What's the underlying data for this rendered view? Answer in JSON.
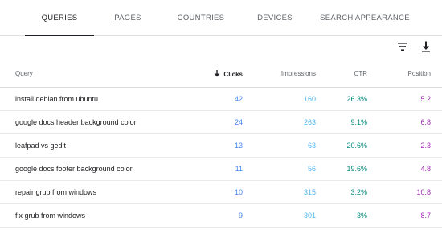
{
  "tabs": [
    {
      "label": "QUERIES",
      "active": true
    },
    {
      "label": "PAGES",
      "active": false
    },
    {
      "label": "COUNTRIES",
      "active": false
    },
    {
      "label": "DEVICES",
      "active": false
    },
    {
      "label": "SEARCH APPEARANCE",
      "active": false
    }
  ],
  "toolbar": {
    "filter_icon": "filter-icon",
    "download_icon": "download-icon"
  },
  "table": {
    "headers": {
      "query": "Query",
      "clicks": "Clicks",
      "impressions": "Impressions",
      "ctr": "CTR",
      "position": "Position"
    },
    "sort_icon": "arrow-down-icon",
    "rows": [
      {
        "query": "install debian from ubuntu",
        "clicks": "42",
        "impressions": "160",
        "ctr": "26.3%",
        "position": "5.2"
      },
      {
        "query": "google docs header background color",
        "clicks": "24",
        "impressions": "263",
        "ctr": "9.1%",
        "position": "6.8"
      },
      {
        "query": "leafpad vs gedit",
        "clicks": "13",
        "impressions": "63",
        "ctr": "20.6%",
        "position": "2.3"
      },
      {
        "query": "google docs footer background color",
        "clicks": "11",
        "impressions": "56",
        "ctr": "19.6%",
        "position": "4.8"
      },
      {
        "query": "repair grub from windows",
        "clicks": "10",
        "impressions": "315",
        "ctr": "3.2%",
        "position": "10.8"
      },
      {
        "query": "fix grub from windows",
        "clicks": "9",
        "impressions": "301",
        "ctr": "3%",
        "position": "8.7"
      }
    ]
  },
  "colors": {
    "clicks": "#4285f4",
    "impressions": "#4bb5f0",
    "ctr": "#00897b",
    "position": "#9c27b0"
  }
}
